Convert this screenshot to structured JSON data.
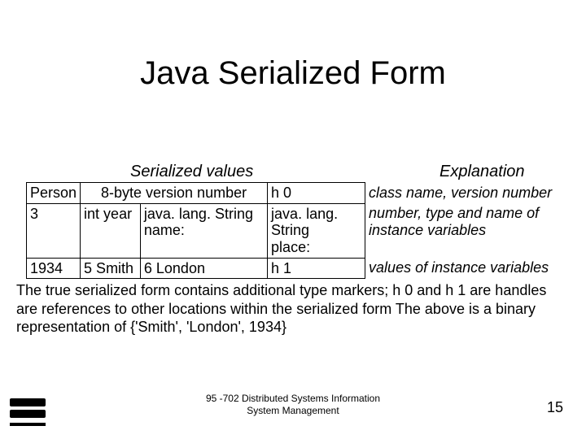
{
  "title": "Java Serialized Form",
  "headers": {
    "left": "Serialized values",
    "right": "Explanation"
  },
  "table": {
    "r1": {
      "c1": "Person",
      "c2": "8-byte version number",
      "c3": "h 0",
      "expl": "class name, version number"
    },
    "r2": {
      "c1": "3",
      "c2": "int year",
      "c3": "java. lang. String\nname:",
      "c4": "java. lang. String\nplace:",
      "expl": "number, type and name of\ninstance variables"
    },
    "r3": {
      "c1": "1934",
      "c2": "5 Smith",
      "c3": "6 London",
      "c4": "h 1",
      "expl": "values of instance variables"
    }
  },
  "paragraph": "The true serialized form contains additional type markers; h 0 and h 1 are handles are references to other locations within the serialized form The above is a binary representation of {'Smith', 'London', 1934}",
  "footer": "95 -702 Distributed Systems Information\nSystem Management",
  "pagenum": "15"
}
